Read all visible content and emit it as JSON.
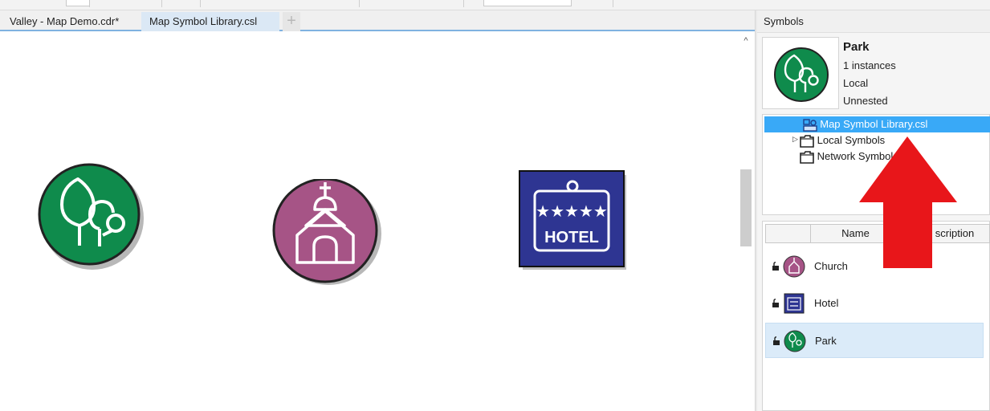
{
  "document_tabs": [
    {
      "label": "Valley - Map Demo.cdr*",
      "active": false
    },
    {
      "label": "Map Symbol Library.csl",
      "active": true
    }
  ],
  "tab_add_icon": "plus-icon",
  "canvas": {
    "symbols": [
      {
        "name": "Park",
        "icon": "park-trees-icon",
        "color": "#0f8b4c"
      },
      {
        "name": "Church",
        "icon": "church-icon",
        "color": "#a65486"
      },
      {
        "name": "Hotel",
        "icon": "hotel-sign-icon",
        "color": "#2e3592",
        "stars_text": "★★★★★",
        "sign_text": "HOTEL"
      }
    ]
  },
  "docker": {
    "title": "Symbols",
    "selected_symbol": {
      "name": "Park",
      "instances": "1 instances",
      "scope": "Local",
      "nesting": "Unnested"
    },
    "tree": [
      {
        "label": "Map Symbol Library.csl",
        "icon": "library-icon",
        "selected": true
      },
      {
        "label": "Local Symbols",
        "icon": "folder-icon",
        "expandable": true
      },
      {
        "label": "Network Symbols",
        "icon": "folder-icon",
        "expandable": false
      }
    ],
    "list_columns": [
      "Name",
      "Description"
    ],
    "list_columns_visible": [
      "Name",
      "scription"
    ],
    "list_items": [
      {
        "name": "Church",
        "icon": "church-icon",
        "locked": true,
        "selected": false
      },
      {
        "name": "Hotel",
        "icon": "hotel-sign-icon",
        "locked": true,
        "selected": false
      },
      {
        "name": "Park",
        "icon": "park-trees-icon",
        "locked": true,
        "selected": true
      }
    ]
  },
  "annotation": {
    "icon": "red-arrow-icon",
    "color": "#e8161a"
  },
  "colors": {
    "selection_blue": "#39a9f7",
    "row_selected": "#dbebf9",
    "tab_accent": "#7fb2e0"
  }
}
